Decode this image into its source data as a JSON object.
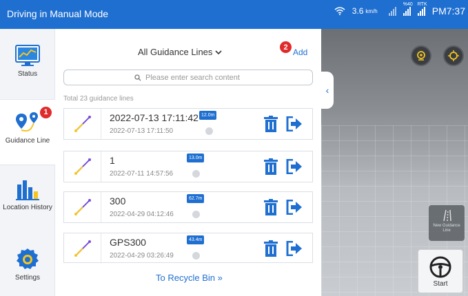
{
  "topbar": {
    "title": "Driving in Manual Mode",
    "speed": "3.6",
    "speed_unit": "km/h",
    "signal_1_label": "%40",
    "signal_2_label": "RTK",
    "time": "PM7:37",
    "bg_color": "#1f6fd0"
  },
  "sidebar": {
    "items": [
      {
        "label": "Status",
        "icon": "monitor-chart-icon"
      },
      {
        "label": "Guidance Line",
        "icon": "map-pin-route-icon",
        "badge": "1"
      },
      {
        "label": "Location History",
        "icon": "bar-chart-icon"
      },
      {
        "label": "Settings",
        "icon": "gear-icon"
      }
    ]
  },
  "panel": {
    "filter_label": "All Guidance Lines",
    "add_label": "Add",
    "add_badge": "2",
    "search_placeholder": "Please enter search content",
    "total_text": "Total 23 guidance lines",
    "recycle_label": "To Recycle Bin"
  },
  "lines": [
    {
      "name": "2022-07-13 17:11:42",
      "date": "2022-07-13 17:11:50",
      "length": "12.0m"
    },
    {
      "name": "1",
      "date": "2022-07-11 14:57:56",
      "length": "13.0m"
    },
    {
      "name": "300",
      "date": "2022-04-29 04:12:46",
      "length": "62.7m"
    },
    {
      "name": "GPS300",
      "date": "2022-04-29 03:26:49",
      "length": "43.4m"
    }
  ],
  "scene": {
    "new_guidance_label": "New Guidance Line",
    "start_label": "Start"
  },
  "colors": {
    "accent": "#1f6fd0",
    "badge_red": "#e02b2b",
    "action_blue": "#1f6fd0"
  }
}
